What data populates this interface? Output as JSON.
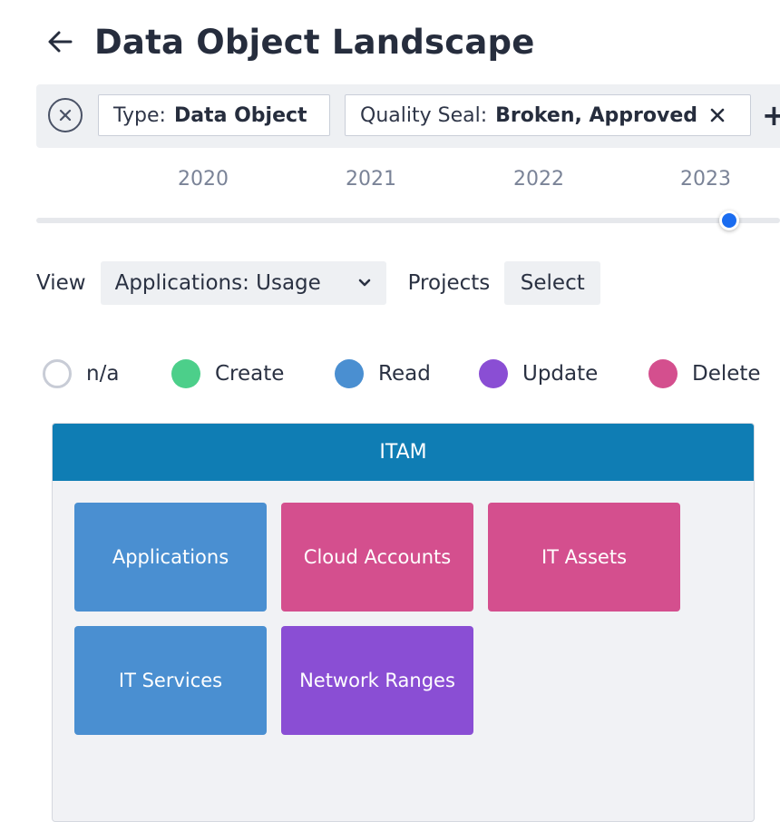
{
  "header": {
    "title": "Data Object Landscape"
  },
  "filters": {
    "chips": [
      {
        "key": "Type:",
        "value": "Data Object"
      },
      {
        "key": "Quality Seal:",
        "value": "Broken, Approved"
      }
    ],
    "add_label": "+"
  },
  "timeline": {
    "years": [
      "2020",
      "2021",
      "2022",
      "2023"
    ],
    "selected_year": "2023"
  },
  "view": {
    "label": "View",
    "selected": "Applications: Usage",
    "projects_label": "Projects",
    "projects_select": "Select"
  },
  "legend": [
    {
      "label": "n/a",
      "color": "#ffffff",
      "border": "#c8ccd6"
    },
    {
      "label": "Create",
      "color": "#4ccf8a"
    },
    {
      "label": "Read",
      "color": "#4a8fd1"
    },
    {
      "label": "Update",
      "color": "#8a4ed4"
    },
    {
      "label": "Delete",
      "color": "#d44f8e"
    }
  ],
  "panel": {
    "title": "ITAM",
    "header_color": "#0f7db4",
    "tiles": [
      {
        "label": "Applications",
        "usage": "Read",
        "color": "#4a8fd1"
      },
      {
        "label": "Cloud Accounts",
        "usage": "Delete",
        "color": "#d44f8e"
      },
      {
        "label": "IT Assets",
        "usage": "Delete",
        "color": "#d44f8e"
      },
      {
        "label": "IT Services",
        "usage": "Read",
        "color": "#4a8fd1"
      },
      {
        "label": "Network Ranges",
        "usage": "Update",
        "color": "#8a4ed4"
      }
    ]
  },
  "icons": {
    "back": "arrow-left-icon",
    "clear": "close-circle-icon",
    "chip_remove": "close-icon",
    "dropdown": "chevron-down-icon"
  }
}
